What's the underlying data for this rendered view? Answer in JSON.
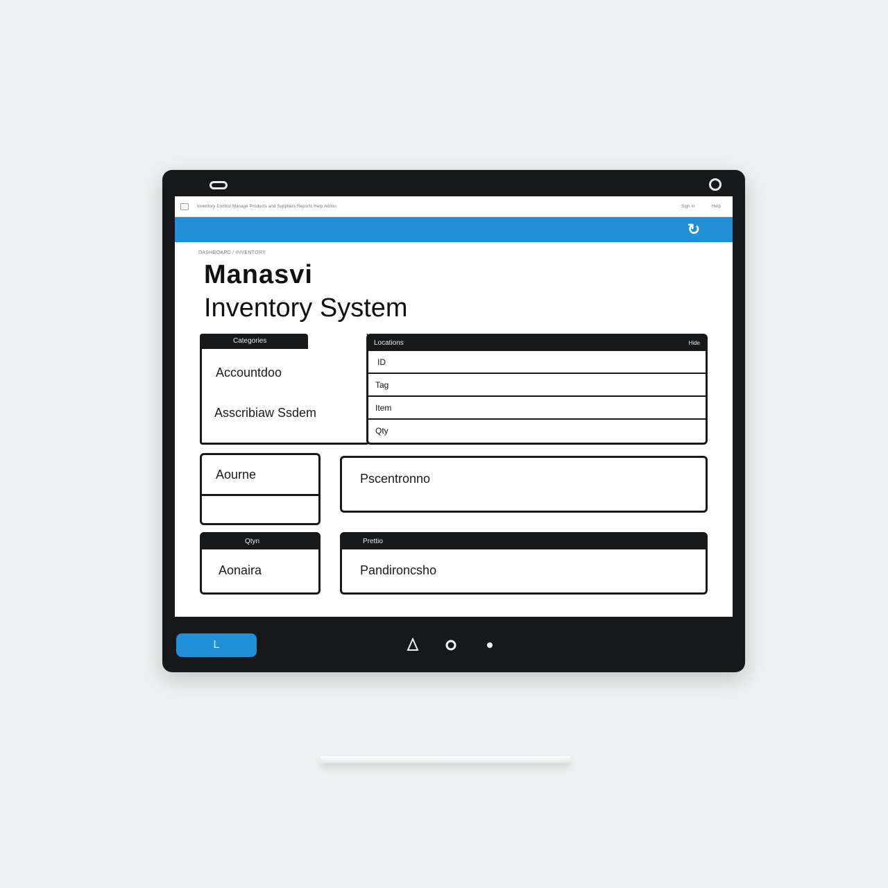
{
  "topbar": {
    "nav_text": "Inventory Control   Manage Products and Suppliers   Reports  Help   Admin",
    "link1": "Sign in",
    "link2": "Help"
  },
  "breadcrumb": "DASHBOARD / INVENTORY",
  "title": {
    "line1": "Manasvi",
    "line2": "Inventory System"
  },
  "panel_left": {
    "header": "Categories",
    "item1": "Accountdoo",
    "item2": "Asscribiaw Ssdem"
  },
  "panel_list": {
    "header": "Locations",
    "header_right": "Hide",
    "rows": [
      "ID",
      "Tag",
      "Item",
      "Qty"
    ]
  },
  "panel_mid_left": {
    "label": "Aourne"
  },
  "panel_mid_right": {
    "label": "Pscentronno"
  },
  "panel_bot_left": {
    "header": "Qtyn",
    "label": "Aonaira"
  },
  "panel_bot_right": {
    "header": "Prettio",
    "label": "Pandironcsho"
  },
  "bottom": {
    "button_label": "L"
  },
  "icons": {
    "refresh": "refresh-icon",
    "back": "back-triangle-icon",
    "home": "home-circle-icon",
    "recent": "dot-icon"
  },
  "colors": {
    "accent": "#1f8fd6",
    "frame": "#16181a"
  }
}
